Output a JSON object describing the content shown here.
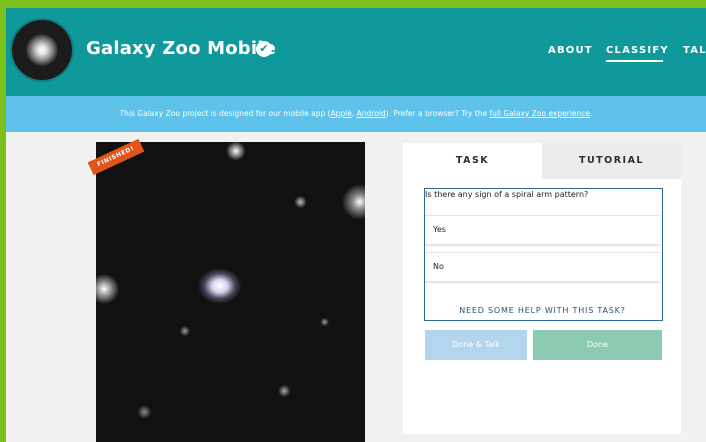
{
  "header": {
    "title": "Galaxy Zoo Mobile",
    "verified_icon": "check-circle-icon",
    "nav": {
      "about": "ABOUT",
      "classify": "CLASSIFY",
      "talk": "TALK"
    },
    "active_nav": "CLASSIFY"
  },
  "banner": {
    "prefix": "This Galaxy Zoo project is designed for our mobile app (",
    "apple": "Apple",
    "sep": ", ",
    "android": "Android",
    "middle": "). Prefer a browser? Try the ",
    "link": "full Galaxy Zoo experience",
    "suffix": "."
  },
  "subject": {
    "badge": "FINISHED!"
  },
  "tabs": {
    "task": "TASK",
    "tutorial": "TUTORIAL",
    "active": "TASK"
  },
  "task": {
    "question": "Is there any sign of a spiral arm pattern?",
    "answers": [
      "Yes",
      "No"
    ],
    "help": "NEED SOME HELP WITH THIS TASK?",
    "done_talk": "Done & Talk",
    "done": "Done"
  },
  "colors": {
    "header": "#10999b",
    "banner": "#5fc2ea",
    "frame": "#7bc11b",
    "badge": "#e2541a",
    "done_talk": "#b3d6ee",
    "done": "#8ccab1"
  }
}
